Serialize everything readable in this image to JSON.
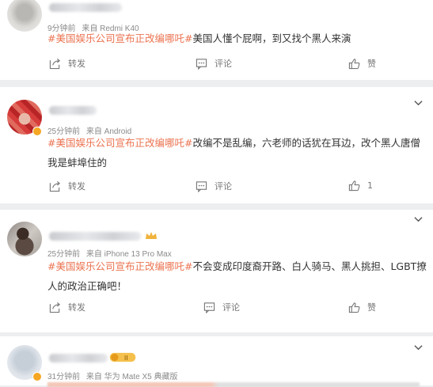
{
  "hashtag": "#美国娱乐公司宣布正改编哪吒#",
  "actions": {
    "share": "转发",
    "comment": "评论",
    "like": "赞"
  },
  "comments": [
    {
      "time": "9分钟前",
      "source": "来自 Redmi K40",
      "text": "美国人懂个屁啊，到又找个黑人来演",
      "like_count": "赞"
    },
    {
      "time": "25分钟前",
      "source": "来自 Android",
      "text": "改编不是乱编，六老师的话犹在耳边，改个黑人唐僧我是蚌埠住的",
      "like_count": "1"
    },
    {
      "time": "25分钟前",
      "source": "来自 iPhone 13 Pro Max",
      "text": "不会变成印度裔开路、白人骑马、黑人挑担、LGBT撩人的政治正确吧！",
      "like_count": "赞"
    },
    {
      "time": "31分钟前",
      "source": "来自 华为 Mate X5 典藏版",
      "text": "",
      "like_count": ""
    }
  ],
  "colors": {
    "hashtag": "#eb7350",
    "verified": "#f5a623",
    "muted": "#8a8a8a"
  },
  "icons": [
    "share-icon",
    "comment-icon",
    "like-icon",
    "chevron-down-icon"
  ]
}
